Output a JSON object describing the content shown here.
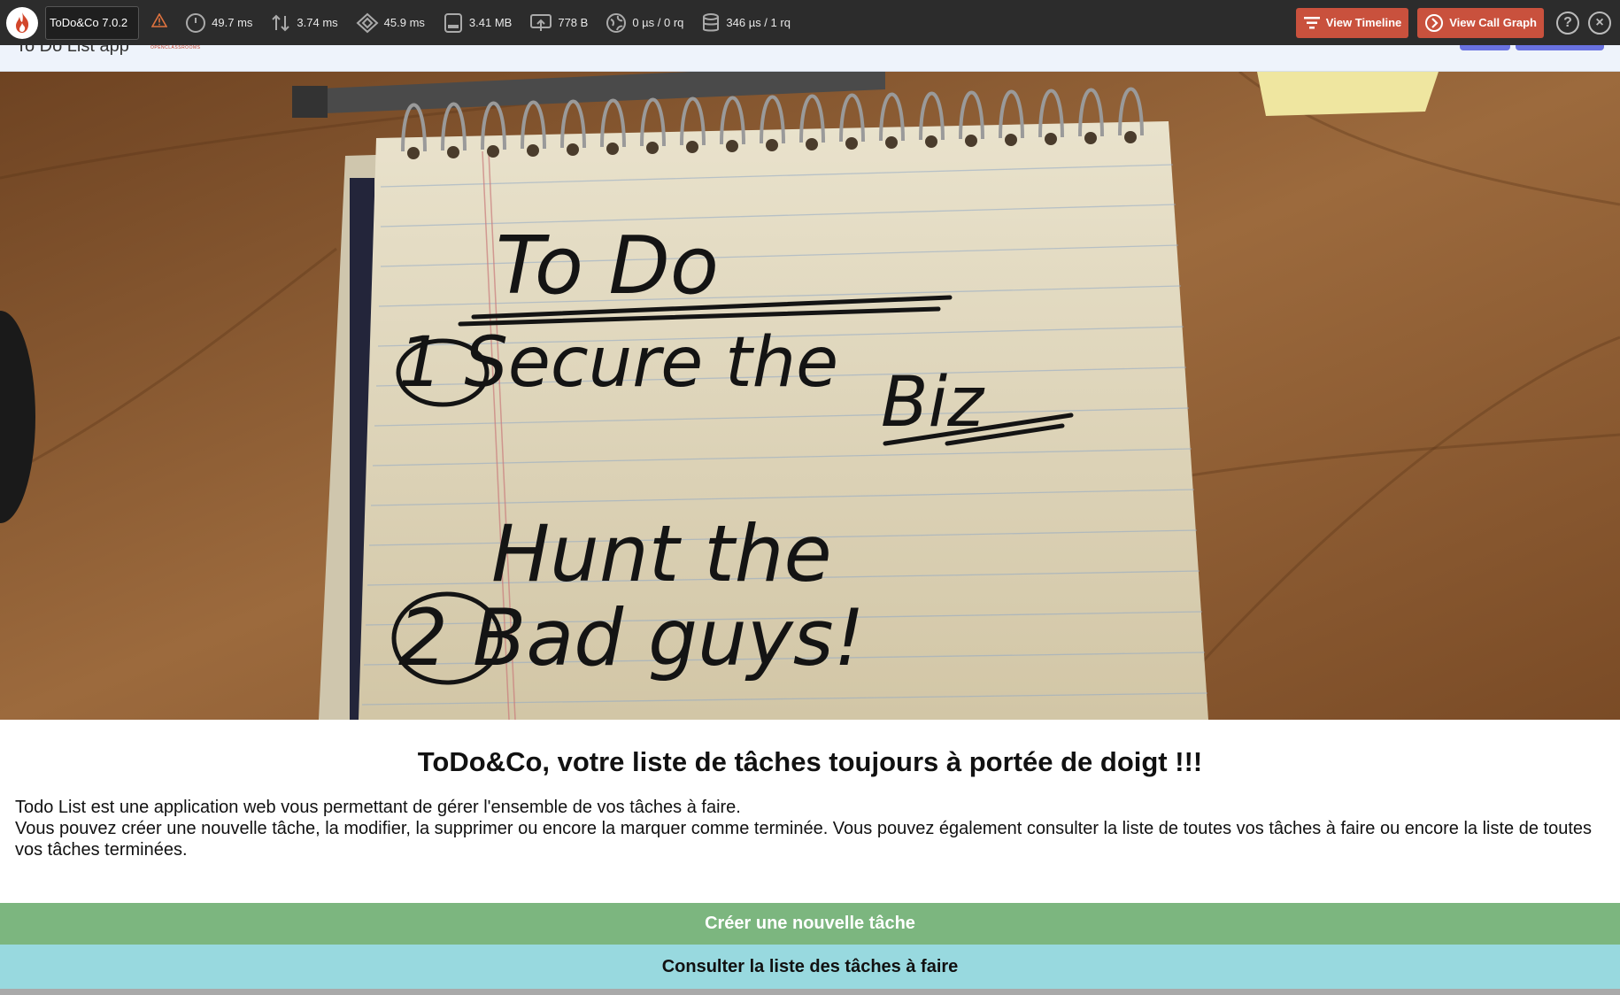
{
  "toolbar": {
    "app_version": "ToDo&Co 7.0.2",
    "metrics": {
      "time": "49.7 ms",
      "io": "3.74 ms",
      "cpu": "45.9 ms",
      "memory": "3.41 MB",
      "network": "778 B",
      "http": "0 µs / 0 rq",
      "sql": "346 µs / 1 rq"
    },
    "view_timeline": "View Timeline",
    "view_call_graph": "View Call Graph",
    "help_symbol": "?",
    "close_symbol": "×",
    "accent_color": "#c9513d",
    "icons": [
      "fire-logo-icon",
      "warning-icon",
      "clock-icon",
      "io-arrows-icon",
      "cpu-icon",
      "memory-icon",
      "network-icon",
      "globe-icon",
      "database-icon",
      "timeline-icon",
      "call-graph-icon",
      "help-icon",
      "close-icon"
    ]
  },
  "navbar": {
    "title": "To Do List app",
    "logo_text": "OPENCLASSROOMS"
  },
  "hero": {
    "note_line1": "To Do",
    "note_line2": "1 Secure the",
    "note_line3": "Biz",
    "note_line4": "Hunt the",
    "note_line5": "2 Bad guys!"
  },
  "main": {
    "headline": "ToDo&Co, votre liste de tâches toujours à portée de doigt !!!",
    "intro_line1": "Todo List est une application web vous permettant de gérer l'ensemble de vos tâches à faire.",
    "intro_line2": "Vous pouvez créer une nouvelle tâche, la modifier, la supprimer ou encore la marquer comme terminée. Vous pouvez également consulter la liste de toutes vos tâches à faire ou encore la liste de toutes vos tâches terminées."
  },
  "actions": {
    "create_label": "Créer une nouvelle tâche",
    "create_color": "#7cb67f",
    "todo_list_label": "Consulter la liste des tâches à faire",
    "todo_list_color": "#98d9df"
  }
}
